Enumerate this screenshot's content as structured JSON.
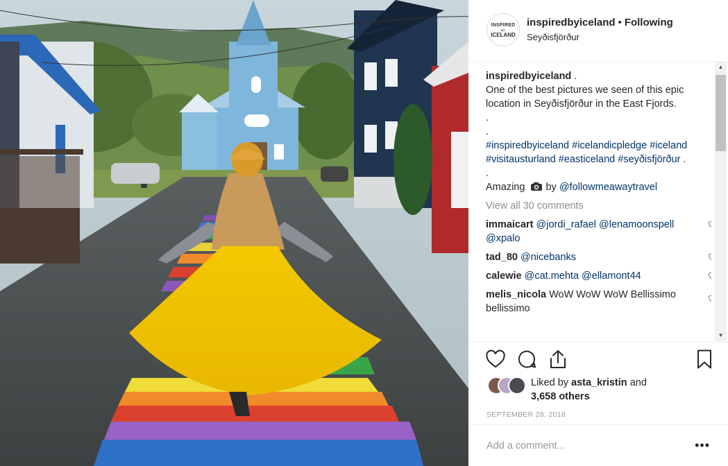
{
  "post": {
    "username": "inspiredbyiceland",
    "separator": "•",
    "follow_label": "Following",
    "location": "Seyðisfjörður",
    "logo": {
      "line1": "INSPIRED",
      "line2": "BY",
      "line3": "ICELAND"
    },
    "caption": {
      "username": "inspiredbyiceland",
      "suffix": " .",
      "text": "One of the best pictures we seen of this epic location in Seyðisfjörður in the East Fjords.",
      "dot1": ".",
      "dot2": ".",
      "hashtags": [
        "#inspiredbyiceland",
        "#icelandicpledge",
        "#iceland",
        "#visitausturland",
        "#easticeland",
        "#seyðisfjörður"
      ],
      "hashtag_end": " .",
      "dot3": ".",
      "credit_prefix": "Amazing",
      "credit_mid": " by ",
      "credit_mention": "@followmeawaytravel"
    },
    "view_all": "View all 30 comments",
    "comments": [
      {
        "user": "immaicart",
        "mentions": [
          "@jordi_rafael",
          "@lenamoonspell",
          "@xpalo"
        ]
      },
      {
        "user": "tad_80",
        "mentions": [
          "@nicebanks"
        ]
      },
      {
        "user": "calewie",
        "mentions": [
          "@cat.mehta",
          "@ellamont44"
        ]
      },
      {
        "user": "melis_nicola",
        "text": "WoW WoW WoW Bellissimo bellissimo"
      }
    ],
    "likes": {
      "prefix": "Liked by",
      "user": "asta_kristin",
      "and": "and",
      "count": "3,658 others"
    },
    "date": "SEPTEMBER 28, 2018",
    "add_comment_placeholder": "Add a comment...",
    "more_label": "•••"
  },
  "icons": [
    "heart-icon",
    "comment-icon",
    "share-icon",
    "bookmark-icon",
    "camera-emoji-icon",
    "more-options-icon"
  ],
  "colors": {
    "link": "#003569",
    "text": "#262626",
    "muted": "#8e8e8e",
    "dress": "#f2c400"
  }
}
